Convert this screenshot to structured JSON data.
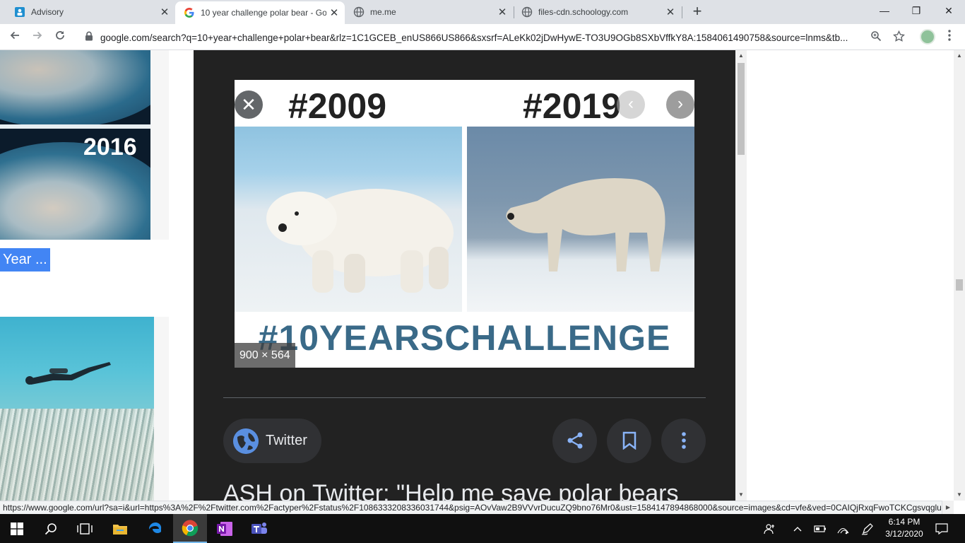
{
  "browser": {
    "tabs": [
      {
        "title": "Advisory",
        "icon": "schoology-icon",
        "active": false
      },
      {
        "title": "10 year challenge polar bear - Go",
        "icon": "google-icon",
        "active": true
      },
      {
        "title": "me.me",
        "icon": "globe-icon",
        "active": false
      },
      {
        "title": "files-cdn.schoology.com",
        "icon": "globe-icon",
        "active": false
      }
    ],
    "new_tab": "+",
    "window_controls": {
      "minimize": "—",
      "maximize": "❐",
      "close": "✕"
    },
    "url_host": "google.com",
    "url_rest": "/search?q=10+year+challenge+polar+bear&rlz=1C1GCEB_enUS866US866&sxsrf=ALeKk02jDwHywE-TO3U9OGb8SXbVffkY8A:1584061490758&source=lnms&tb..."
  },
  "results": {
    "thumb_year": "2016",
    "result_label": "Year ..."
  },
  "preview": {
    "image_year_left": "#2009",
    "image_year_right": "#2019",
    "image_hashtag": "#10YEARSCHALLENGE",
    "dimensions": "900 × 564",
    "source_name": "Twitter",
    "title": "ASH on Twitter: \"Help me save polar bears"
  },
  "status_url": "https://www.google.com/url?sa=i&url=https%3A%2F%2Ftwitter.com%2Factyper%2Fstatus%2F1086333208336031744&psig=AOvVaw2B9VVvrDucuZQ9bno76Mr0&ust=1584147894868000&source=images&cd=vfe&ved=0CAIQjRxqFwoTCKCgsvqglu...",
  "taskbar": {
    "time": "6:14 PM",
    "date": "3/12/2020"
  },
  "colors": {
    "tabstrip": "#dee1e6",
    "preview_bg": "#222222",
    "chip_bg": "#303134",
    "accent_blue": "#4285f4",
    "taskbar": "#101010"
  }
}
